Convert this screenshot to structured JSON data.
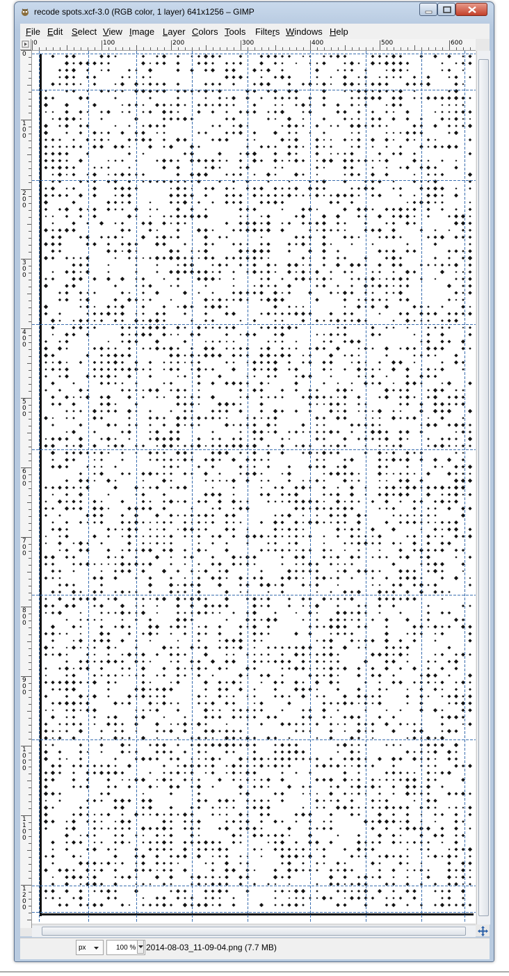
{
  "window": {
    "title": "recode spots.xcf-3.0 (RGB color, 1 layer) 641x1256 – GIMP"
  },
  "menu": [
    {
      "label": "File",
      "u": "F",
      "rest": "ile"
    },
    {
      "label": "Edit",
      "u": "E",
      "rest": "dit"
    },
    {
      "label": "Select",
      "u": "S",
      "rest": "elect"
    },
    {
      "label": "View",
      "u": "V",
      "rest": "iew"
    },
    {
      "label": "Image",
      "u": "I",
      "rest": "mage"
    },
    {
      "label": "Layer",
      "u": "L",
      "rest": "ayer"
    },
    {
      "label": "Colors",
      "u": "C",
      "rest": "olors"
    },
    {
      "label": "Tools",
      "u": "T",
      "rest": "ools"
    },
    {
      "label": "Filters",
      "pre": "Filte",
      "u": "r",
      "rest": "s"
    },
    {
      "label": "Windows",
      "u": "W",
      "rest": "indows"
    },
    {
      "label": "Help",
      "u": "H",
      "rest": "elp"
    }
  ],
  "rulers": {
    "horizontal": [
      "0",
      "100",
      "200",
      "300",
      "400",
      "500",
      "600"
    ],
    "vertical": [
      "0",
      "100",
      "200",
      "300",
      "400",
      "500",
      "600",
      "700",
      "800",
      "900",
      "1000",
      "1100",
      "1200"
    ]
  },
  "status": {
    "unit": "px",
    "zoom": "100 %",
    "file_info": "2014-08-03_11-09-04.png (7.7 MB)"
  },
  "colors": {
    "guide": "#3b6fb0",
    "spot": "#111111"
  }
}
